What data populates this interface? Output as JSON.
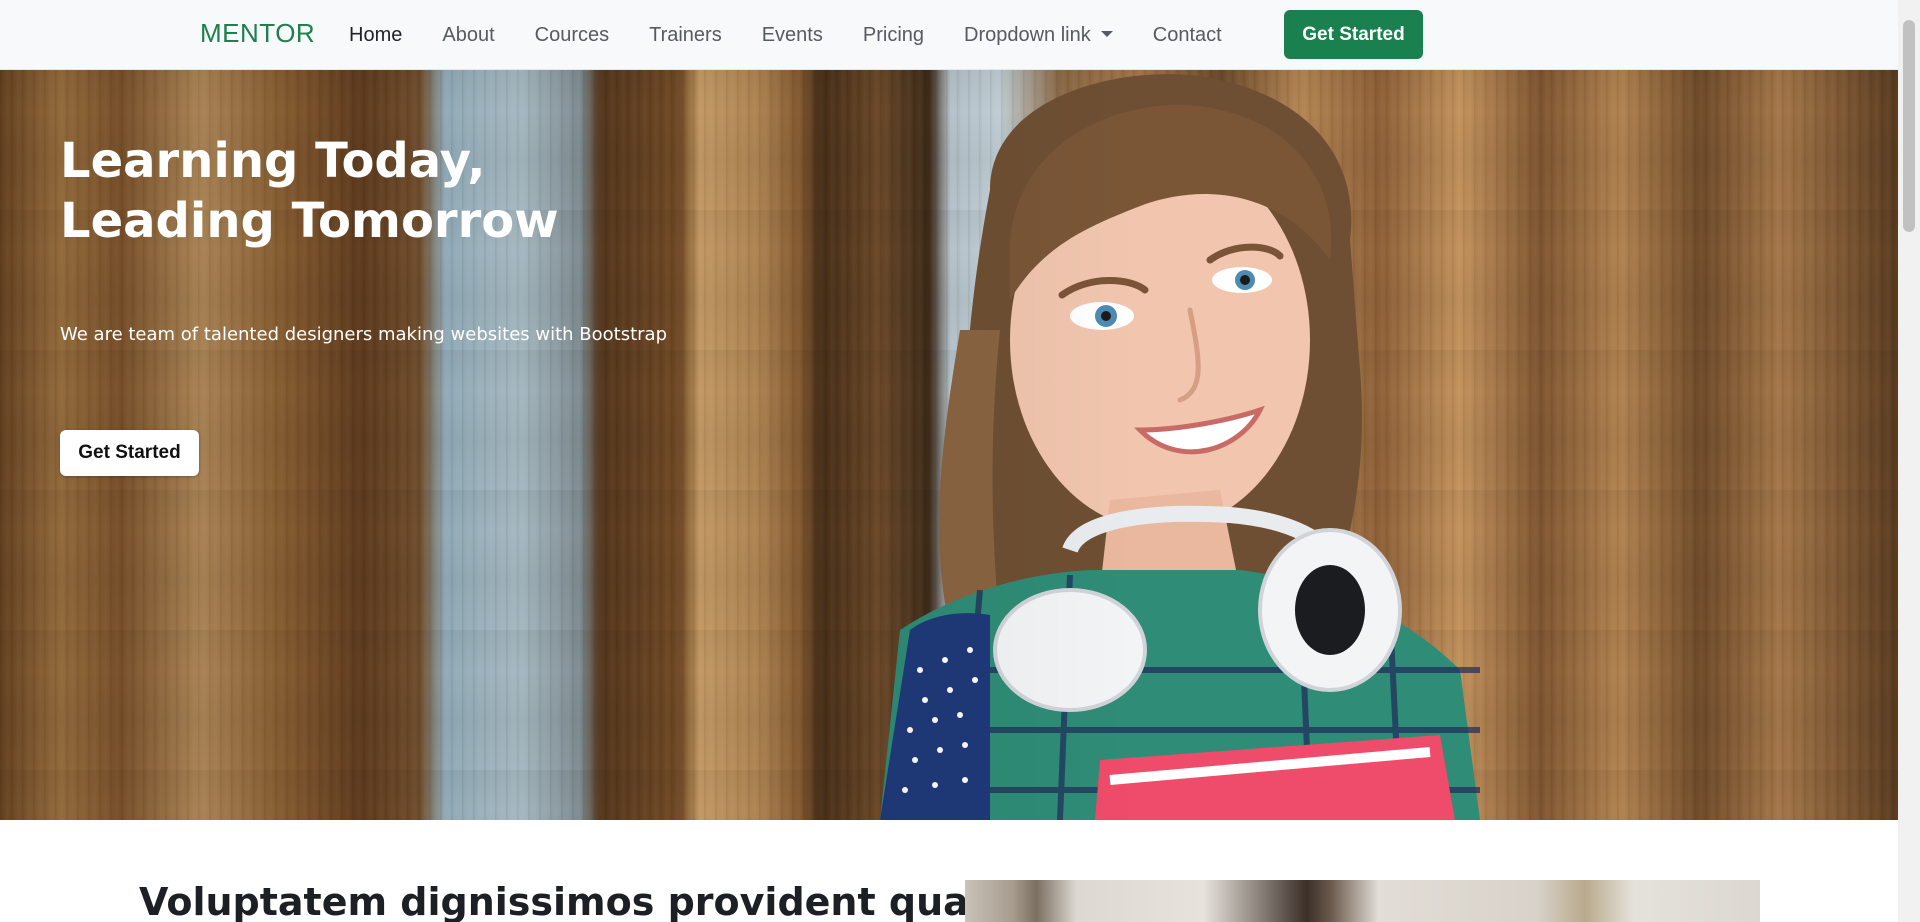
{
  "navbar": {
    "brand": "MENTOR",
    "links": [
      {
        "label": "Home",
        "active": true
      },
      {
        "label": "About"
      },
      {
        "label": "Cources"
      },
      {
        "label": "Trainers"
      },
      {
        "label": "Events"
      },
      {
        "label": "Pricing"
      },
      {
        "label": "Dropdown link",
        "dropdown": true
      },
      {
        "label": "Contact"
      }
    ],
    "cta_label": "Get Started"
  },
  "hero": {
    "title_line1": "Learning Today,",
    "title_line2": "Leading Tomorrow",
    "subtitle": "We are team of talented designers making websites with Bootstrap",
    "button_label": "Get Started"
  },
  "section": {
    "heading": "Voluptatem dignissimos provident quasi"
  },
  "colors": {
    "brand": "#1e7f4f",
    "cta_bg": "#1a8050",
    "navbar_bg": "#f8f9fa",
    "hero_text": "#ffffff"
  }
}
